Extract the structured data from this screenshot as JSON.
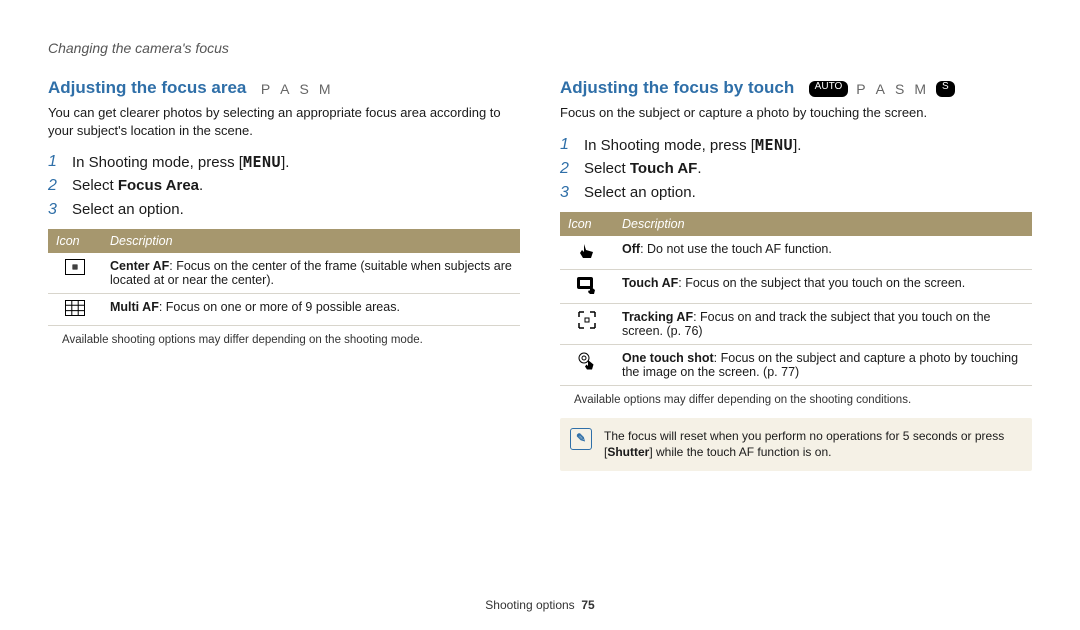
{
  "page_header": "Changing the camera's focus",
  "page_footer_label": "Shooting options",
  "page_number": "75",
  "left": {
    "title": "Adjusting the focus area",
    "modes": [
      "P",
      "A",
      "S",
      "M"
    ],
    "intro": "You can get clearer photos by selecting an appropriate focus area according to your subject's location in the scene.",
    "steps": [
      {
        "num": "1",
        "pre": "In Shooting mode, press [",
        "menu": "MENU",
        "post": "]."
      },
      {
        "num": "2",
        "pre": "Select ",
        "bold": "Focus Area",
        "post": "."
      },
      {
        "num": "3",
        "pre": "Select an option.",
        "menu": "",
        "post": ""
      }
    ],
    "table": {
      "h1": "Icon",
      "h2": "Description",
      "rows": [
        {
          "icon": "center-af-icon",
          "name": "Center AF",
          "desc": ": Focus on the center of the frame (suitable when subjects are located at or near the center)."
        },
        {
          "icon": "multi-af-icon",
          "name": "Multi AF",
          "desc": ": Focus on one or more of 9 possible areas."
        }
      ]
    },
    "footnote": "Available shooting options may differ depending on the shooting mode."
  },
  "right": {
    "title": "Adjusting the focus by touch",
    "modes_pills": [
      "AUTO"
    ],
    "modes": [
      "P",
      "A",
      "S",
      "M"
    ],
    "modes_pills_after": [
      "S"
    ],
    "intro": "Focus on the subject or capture a photo by touching the screen.",
    "steps": [
      {
        "num": "1",
        "pre": "In Shooting mode, press [",
        "menu": "MENU",
        "post": "]."
      },
      {
        "num": "2",
        "pre": "Select ",
        "bold": "Touch AF",
        "post": "."
      },
      {
        "num": "3",
        "pre": "Select an option.",
        "menu": "",
        "post": ""
      }
    ],
    "table": {
      "h1": "Icon",
      "h2": "Description",
      "rows": [
        {
          "icon": "off-icon",
          "name": "Off",
          "desc": ": Do not use the touch AF function."
        },
        {
          "icon": "touch-af-icon",
          "name": "Touch AF",
          "desc": ": Focus on the subject that you touch on the screen."
        },
        {
          "icon": "tracking-af-icon",
          "name": "Tracking AF",
          "desc": ": Focus on and track the subject that you touch on the screen. (p. 76)"
        },
        {
          "icon": "one-touch-icon",
          "name": "One touch shot",
          "desc": ": Focus on the subject and capture a photo by touching the image on the screen. (p. 77)"
        }
      ]
    },
    "footnote": "Available options may differ depending on the shooting conditions.",
    "note_pre": "The focus will reset when you perform no operations for 5 seconds or press [",
    "note_bold": "Shutter",
    "note_post": "] while the touch AF function is on."
  }
}
